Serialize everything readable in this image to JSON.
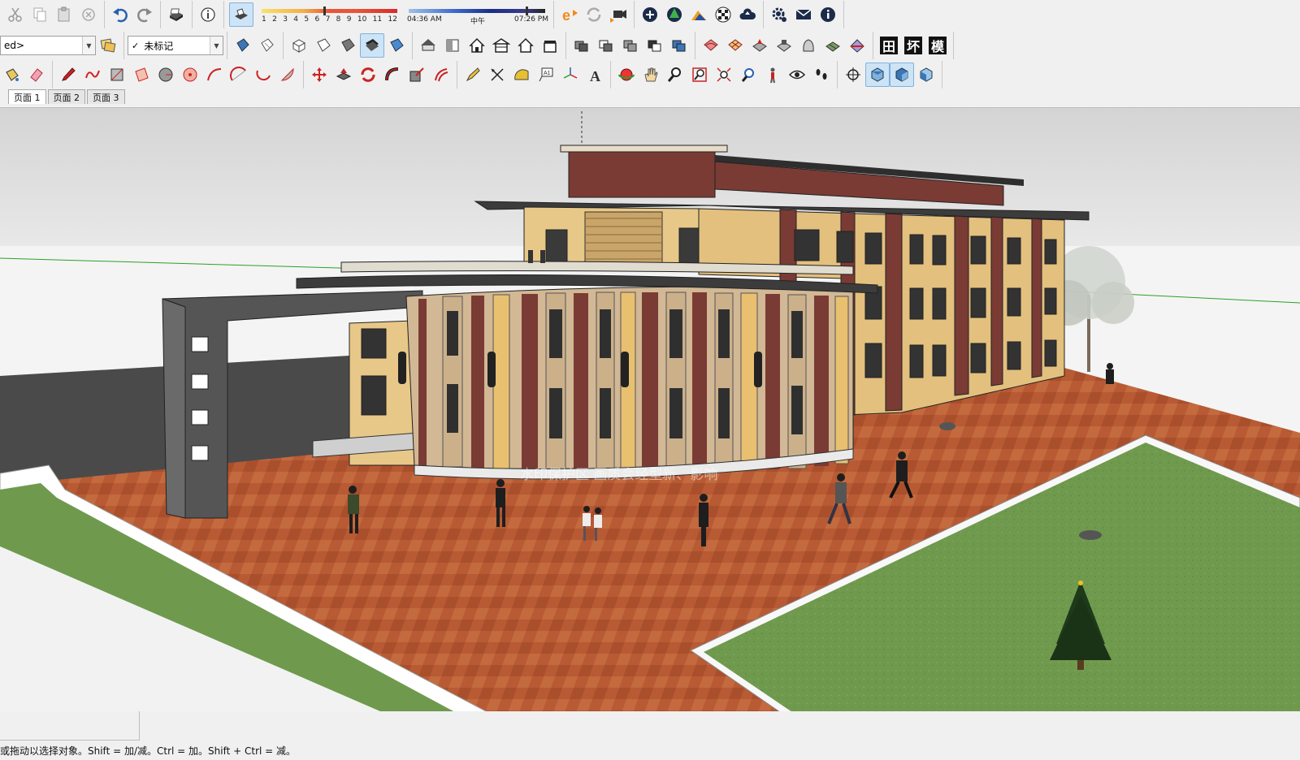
{
  "toolbar": {
    "layer_combo": "ed>",
    "tag_combo": "未标记",
    "tag_check": "✓"
  },
  "shadow": {
    "month_ticks": [
      "1",
      "2",
      "3",
      "4",
      "5",
      "6",
      "7",
      "8",
      "9",
      "10",
      "11",
      "12"
    ],
    "time_start": "04:36 AM",
    "time_mid": "中午",
    "time_end": "07:26 PM"
  },
  "style_buttons": [
    "田",
    "坏",
    "模"
  ],
  "scene_tabs": [
    {
      "label": "页面 1",
      "selected": true
    },
    {
      "label": "页面 2",
      "selected": false
    },
    {
      "label": "页面 3",
      "selected": false
    }
  ],
  "viewport": {
    "watermark_text": "水印保护区  画质会经型新、影响"
  },
  "status": {
    "hint": "或拖动以选择对象。Shift = 加/减。Ctrl = 加。Shift + Ctrl = 减。"
  },
  "colors": {
    "toolbar_bg": "#f0f0f0",
    "sky": "#dcdcdc",
    "ground": "#f4f4f4",
    "paving": "#b85a34",
    "lawn": "#6f9a4e",
    "wall_yellow": "#e8c888",
    "wall_brick": "#7a3b34",
    "roof": "#3c3c3c",
    "axis_green": "#2aa02a"
  }
}
